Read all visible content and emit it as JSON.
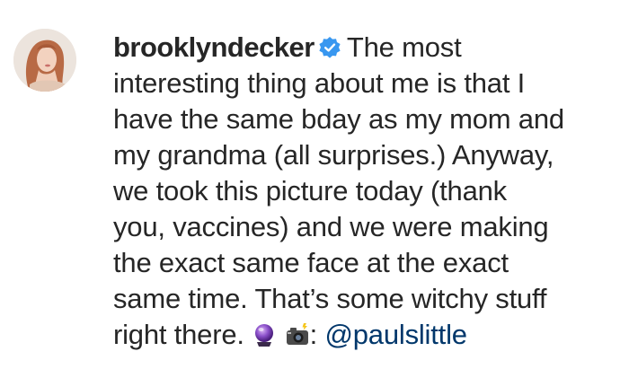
{
  "comment": {
    "username": "brooklyndecker",
    "verified_icon": "verified-badge-icon",
    "lines": [
      "The most",
      "interesting thing about me is that I",
      "have the same bday as my mom and",
      "my grandma (all surprises.) Anyway,",
      "we took this picture today (thank",
      "you, vaccines) and we were making",
      "the exact same face at the exact",
      "same time. That’s some witchy stuff",
      "right there."
    ],
    "emojis": [
      "crystal-ball-icon",
      "camera-with-flash-icon"
    ],
    "credit_colon": ":",
    "mention": "@paulslittle"
  },
  "colors": {
    "text": "#262626",
    "verified_badge": "#3897f0",
    "mention": "#00376b"
  }
}
